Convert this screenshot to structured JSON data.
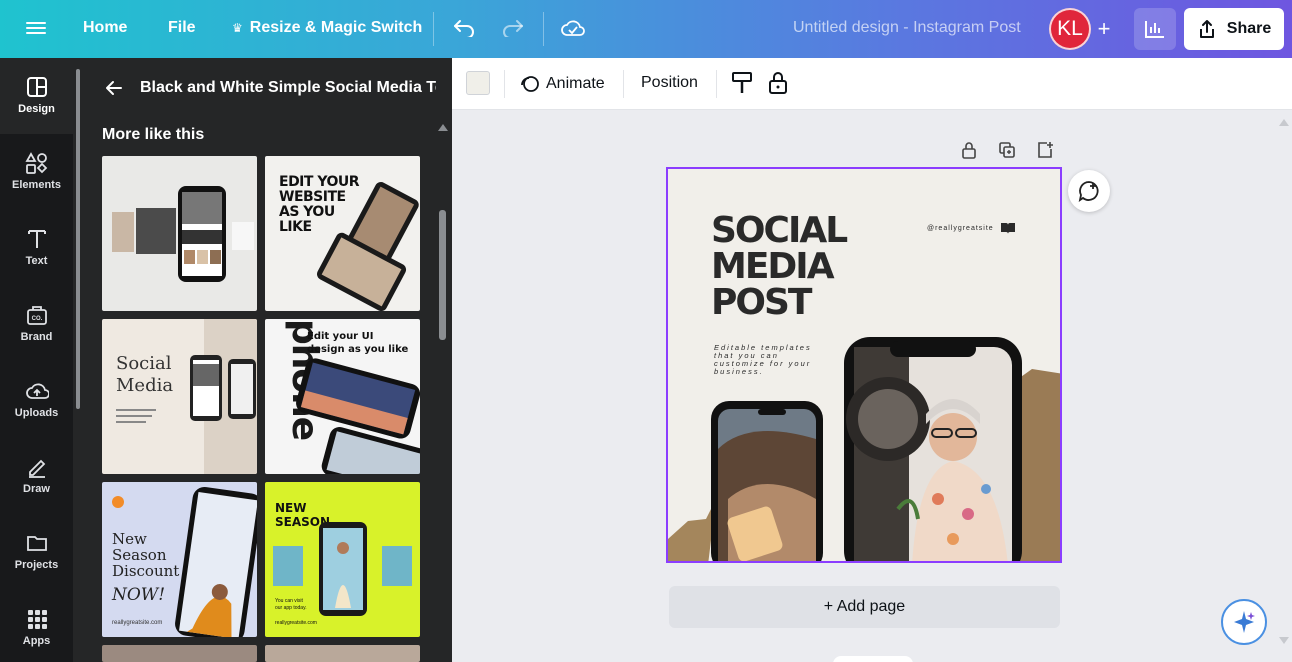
{
  "topbar": {
    "home": "Home",
    "file": "File",
    "resize": "Resize & Magic Switch",
    "doc_title": "Untitled design - Instagram Post",
    "avatar_initials": "KL",
    "share": "Share"
  },
  "rail": {
    "items": [
      {
        "label": "Design",
        "icon": "design-icon"
      },
      {
        "label": "Elements",
        "icon": "elements-icon"
      },
      {
        "label": "Text",
        "icon": "text-icon"
      },
      {
        "label": "Brand",
        "icon": "brand-icon"
      },
      {
        "label": "Uploads",
        "icon": "uploads-icon"
      },
      {
        "label": "Draw",
        "icon": "draw-icon"
      },
      {
        "label": "Projects",
        "icon": "projects-icon"
      },
      {
        "label": "Apps",
        "icon": "apps-icon"
      }
    ]
  },
  "panel": {
    "title": "Black and White Simple Social Media Te...",
    "section": "More like this",
    "templates": [
      {
        "name": "phone-grid-template"
      },
      {
        "name": "edit-your-website-template",
        "text": "EDIT YOUR WEBSITE AS YOU LIKE"
      },
      {
        "name": "social-media-serif-template",
        "text": "Social Media",
        "sub": "Templates you can edit for your business."
      },
      {
        "name": "edit-ui-design-template",
        "text": "Edit your UI design as you like"
      },
      {
        "name": "new-season-discount-template",
        "text": "New Season Discount NOW!",
        "sub": "reallygreatsite.com"
      },
      {
        "name": "new-season-yellow-template",
        "text": "NEW SEASON",
        "sub": "reallygreatsite.com"
      }
    ]
  },
  "context_bar": {
    "animate": "Animate",
    "position": "Position",
    "swatch_color": "#f0efe9"
  },
  "design": {
    "title_line1": "SOCIAL",
    "title_line2": "MEDIA",
    "title_line3": "POST",
    "handle": "@reallygreatsite",
    "description": "Editable templates that you can customize for your business."
  },
  "add_page": "+ Add page",
  "colors": {
    "accent": "#8b3dff",
    "rail_bg": "#18191b",
    "panel_bg": "#252627",
    "avatar": "#e0263b"
  }
}
